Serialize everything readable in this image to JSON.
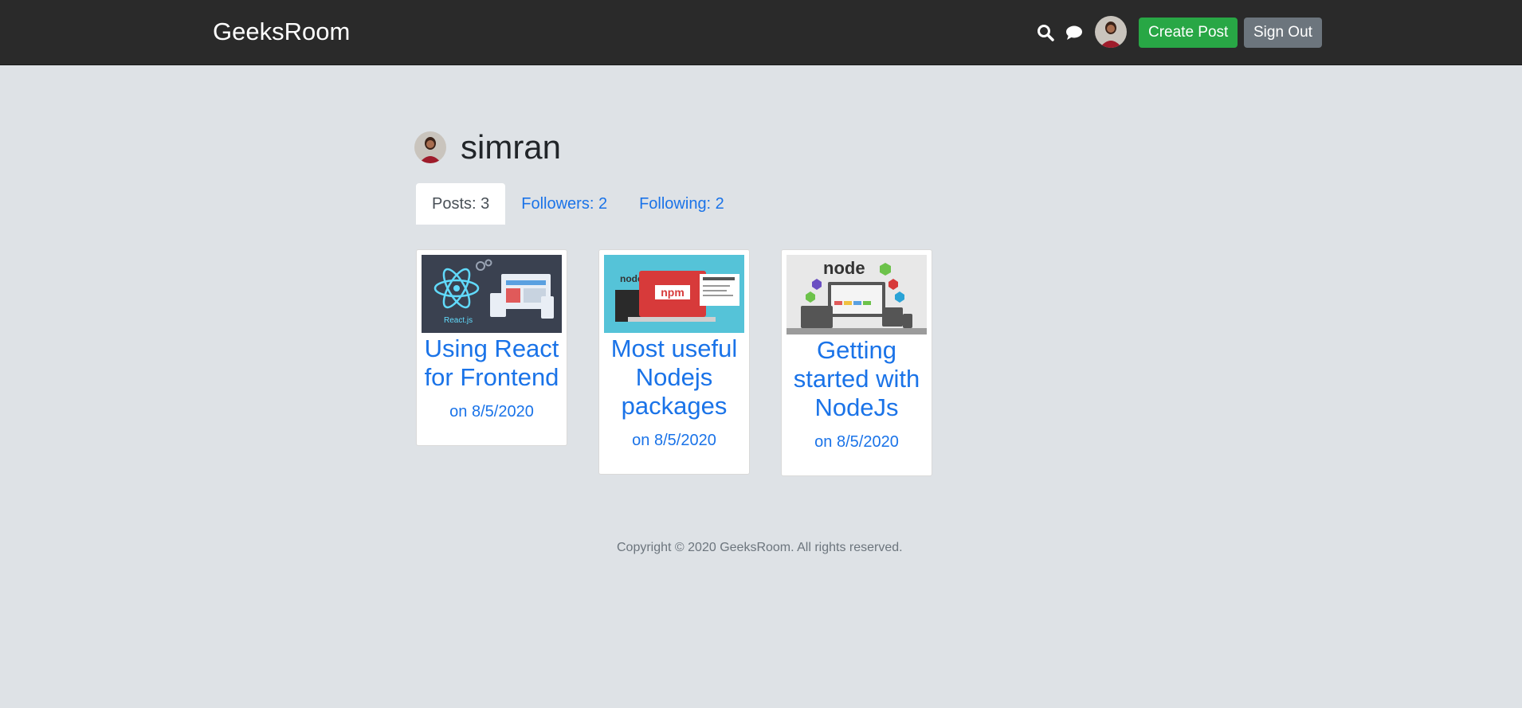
{
  "header": {
    "brand": "GeeksRoom",
    "icons": [
      "search-icon",
      "chat-icon"
    ],
    "create_post_label": "Create Post",
    "sign_out_label": "Sign Out"
  },
  "profile": {
    "username": "simran",
    "tabs": [
      {
        "label": "Posts: 3",
        "active": true
      },
      {
        "label": "Followers: 2",
        "active": false
      },
      {
        "label": "Following: 2",
        "active": false
      }
    ]
  },
  "posts": [
    {
      "title": "Using React for Frontend",
      "date": "on 8/5/2020",
      "thumb_label": "React.js"
    },
    {
      "title": "Most useful Nodejs packages",
      "date": "on 8/5/2020",
      "thumb_label": "npm"
    },
    {
      "title": "Getting started with NodeJs",
      "date": "on 8/5/2020",
      "thumb_label": "node"
    }
  ],
  "footer": {
    "copyright": "Copyright © 2020 GeeksRoom. All rights reserved."
  },
  "colors": {
    "header_bg": "#2a2a2a",
    "page_bg": "#dee2e6",
    "link": "#1a73e8",
    "create_button": "#28a745",
    "sign_out_button": "#6c757d"
  }
}
